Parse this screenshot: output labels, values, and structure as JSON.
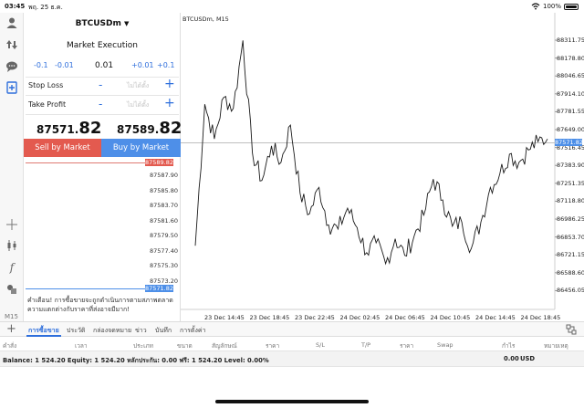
{
  "status": {
    "time": "03:45",
    "date": "พฤ. 25 ธ.ค.",
    "battery": "100%"
  },
  "sidebar": {
    "timeframe": "M15"
  },
  "order": {
    "symbol": "BTCUSDm",
    "title": "Market Execution",
    "volume_steps": [
      "-0.1",
      "-0.01",
      "0.01",
      "+0.01",
      "+0.1"
    ],
    "stop_loss_label": "Stop Loss",
    "take_profit_label": "Take Profit",
    "placeholder": "ไม่ได้ตั้ง",
    "minus": "-",
    "plus": "+",
    "sell_price_main": "87571.",
    "sell_price_big": "82",
    "buy_price_main": "87589.",
    "buy_price_big": "82",
    "sell_label": "Sell by Market",
    "buy_label": "Buy by Market",
    "ladder_top": "87589.82",
    "ladder": [
      "87587.90",
      "87585.80",
      "87583.70",
      "87581.60",
      "87579.50",
      "87577.40",
      "87575.30",
      "87573.20"
    ],
    "ladder_bottom": "87571.82",
    "warning": "คำเตือน! การซื้อขายจะถูกดำเนินการตามสภาพตลาด ความแตกต่างกับราคาที่ส่งอาจมีมาก!"
  },
  "chart": {
    "title": "BTCUSDm, M15",
    "current_price": "87571.82",
    "y_ticks": [
      "88311.75",
      "88178.80",
      "88046.65",
      "87914.10",
      "87781.55",
      "87649.00",
      "87516.45",
      "87383.90",
      "87251.35",
      "87118.80",
      "86986.25",
      "86853.70",
      "86721.15",
      "86588.60",
      "86456.05"
    ],
    "x_ticks": [
      "23 Dec 14:45",
      "23 Dec 18:45",
      "23 Dec 22:45",
      "24 Dec 02:45",
      "24 Dec 06:45",
      "24 Dec 10:45",
      "24 Dec 14:45",
      "24 Dec 18:45"
    ]
  },
  "chart_data": {
    "type": "line",
    "title": "BTCUSDm, M15",
    "ylim": [
      86456.05,
      88311.75
    ],
    "x": [
      "23 Dec 14:45",
      "23 Dec 18:45",
      "23 Dec 22:45",
      "24 Dec 02:45",
      "24 Dec 06:45",
      "24 Dec 10:45",
      "24 Dec 14:45",
      "24 Dec 18:45"
    ],
    "values": [
      86830,
      87850,
      87600,
      87900,
      87820,
      88310,
      87500,
      87300,
      87550,
      87430,
      87700,
      87210,
      87060,
      87250,
      86980,
      86950,
      87100,
      86960,
      86780,
      86850,
      86700,
      86880,
      86760,
      86900,
      87050,
      87310,
      87160,
      86970,
      87000,
      86810,
      87000,
      87250,
      87350,
      87490,
      87430,
      87520,
      87580,
      87600
    ],
    "current": 87571.82,
    "grid": false
  },
  "tabs": [
    "การซื้อขาย",
    "ประวัติ",
    "กล่องจดหมาย",
    "ข่าว",
    "บันทึก",
    "การตั้งค่า"
  ],
  "columns": [
    "คำสั่ง",
    "เวลา",
    "ประเภท",
    "ขนาด",
    "สัญลักษณ์",
    "ราคา",
    "S/L",
    "T/P",
    "ราคา",
    "Swap",
    "กำไร",
    "หมายเหตุ"
  ],
  "balance": {
    "text": "Balance: 1 524.20 Equity: 1 524.20 หลักประกัน: 0.00 ฟรี: 1 524.20 Level: 0.00%",
    "amount": "0.00",
    "currency": "USD"
  }
}
